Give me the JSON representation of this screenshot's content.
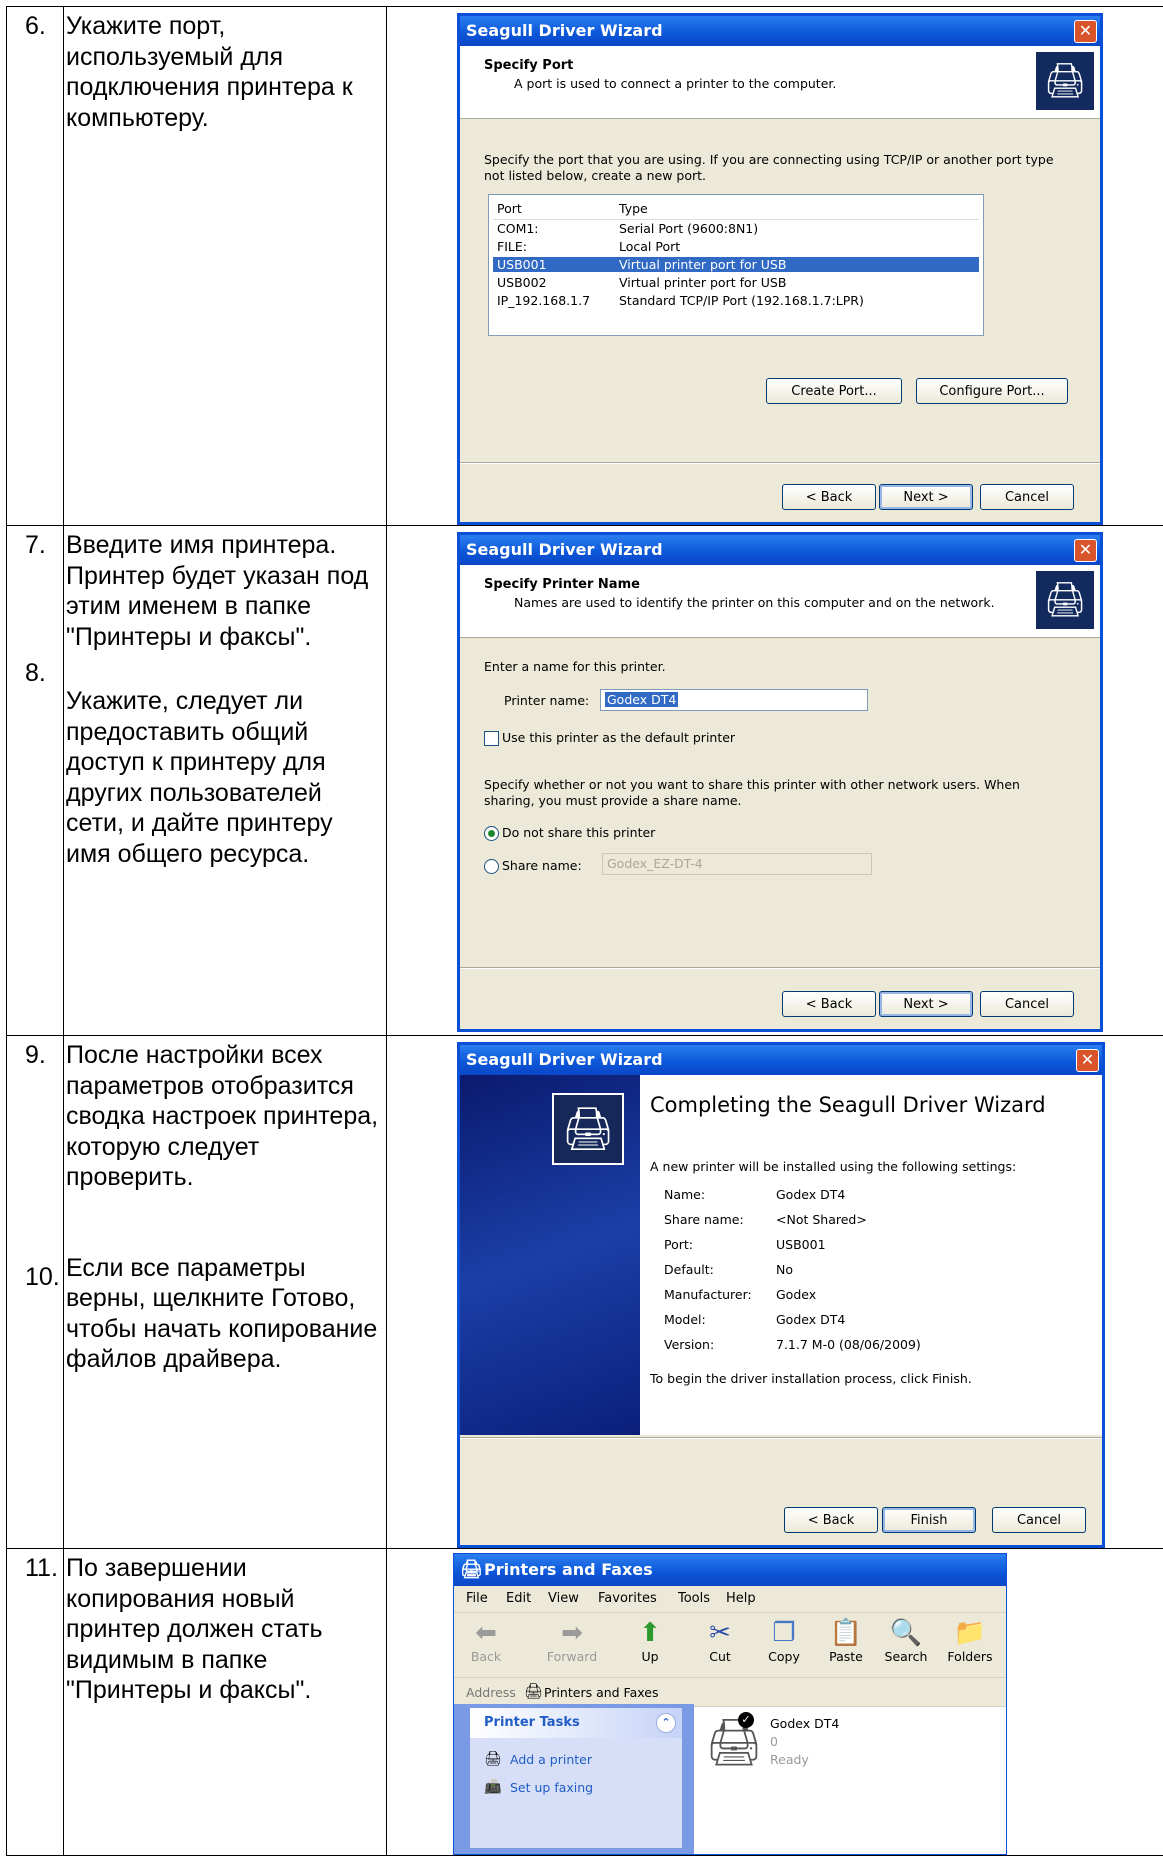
{
  "rows": [
    {
      "steps": [
        {
          "num": "6.",
          "text": "Укажите порт, используемый для подключения принтера к компьютеру."
        }
      ]
    },
    {
      "steps": [
        {
          "num": "7.",
          "text": "Введите имя принтера. Принтер будет указан под этим именем в папке \"Принтеры и факсы\"."
        },
        {
          "num": "8.",
          "text": "Укажите, следует ли предоставить общий доступ к принтеру для других пользователей сети, и дайте принтеру имя общего ресурса."
        }
      ]
    },
    {
      "steps": [
        {
          "num": "9.",
          "text": "После настройки всех параметров отобразится сводка настроек принтера, которую следует проверить."
        },
        {
          "num": "10.",
          "text": "Если все параметры верны, щелкните Готово, чтобы начать копирование файлов драйвера."
        }
      ]
    },
    {
      "steps": [
        {
          "num": "11.",
          "text": "По завершении копирования новый принтер должен стать видимым в папке \"Принтеры и факсы\"."
        }
      ]
    }
  ],
  "wizard": {
    "title": "Seagull Driver Wizard",
    "back": "< Back",
    "next": "Next >",
    "cancel": "Cancel",
    "finish": "Finish",
    "port": {
      "heading": "Specify Port",
      "subheading": "A port is used to connect a printer to the computer.",
      "instructions": "Specify the port that you are using.  If you are connecting using TCP/IP or another port type not listed below, create a new port.",
      "col_port": "Port",
      "col_type": "Type",
      "ports": [
        {
          "port": "COM1:",
          "type": "Serial Port (9600:8N1)"
        },
        {
          "port": "FILE:",
          "type": "Local Port"
        },
        {
          "port": "USB001",
          "type": "Virtual printer port for USB"
        },
        {
          "port": "USB002",
          "type": "Virtual printer port for USB"
        },
        {
          "port": "IP_192.168.1.7",
          "type": "Standard TCP/IP Port (192.168.1.7:LPR)"
        }
      ],
      "selected_index": 2,
      "create_port": "Create Port...",
      "configure_port": "Configure Port..."
    },
    "name": {
      "heading": "Specify Printer Name",
      "subheading": "Names are used to identify the printer on this computer and on the network.",
      "enter_label": "Enter a name for this printer.",
      "printer_name_label": "Printer name:",
      "printer_name_value": "Godex DT4",
      "default_checkbox": "Use this printer as the default printer",
      "share_instructions": "Specify whether or not you want to share this printer with other network users.  When sharing, you must provide a share name.",
      "no_share": "Do not share this printer",
      "share_label": "Share name:",
      "share_value": "Godex_EZ-DT-4"
    },
    "complete": {
      "heading": "Completing the Seagull Driver Wizard",
      "intro": "A new printer will be installed using the following settings:",
      "settings": [
        {
          "label": "Name:",
          "value": "Godex DT4"
        },
        {
          "label": "Share name:",
          "value": "<Not Shared>"
        },
        {
          "label": "Port:",
          "value": "USB001"
        },
        {
          "label": "Default:",
          "value": "No"
        },
        {
          "label": "Manufacturer:",
          "value": "Godex"
        },
        {
          "label": "Model:",
          "value": "Godex DT4"
        },
        {
          "label": "Version:",
          "value": "7.1.7 M-0 (08/06/2009)"
        }
      ],
      "outro": "To begin the driver installation process, click Finish."
    }
  },
  "explorer": {
    "title": "Printers and Faxes",
    "menu": [
      "File",
      "Edit",
      "View",
      "Favorites",
      "Tools",
      "Help"
    ],
    "toolbar": [
      {
        "label": "Back",
        "icon": "back-arrow-icon"
      },
      {
        "label": "Forward",
        "icon": "forward-arrow-icon"
      },
      {
        "label": "Up",
        "icon": "up-folder-icon"
      },
      {
        "label": "Cut",
        "icon": "scissors-icon"
      },
      {
        "label": "Copy",
        "icon": "copy-icon"
      },
      {
        "label": "Paste",
        "icon": "paste-icon"
      },
      {
        "label": "Search",
        "icon": "magnifier-icon"
      },
      {
        "label": "Folders",
        "icon": "folders-icon"
      }
    ],
    "address_label": "Address",
    "address_value": "Printers and Faxes",
    "tasks_title": "Printer Tasks",
    "tasks": [
      "Add a printer",
      "Set up faxing"
    ],
    "printer": {
      "name": "Godex DT4",
      "docs": "0",
      "status": "Ready"
    }
  }
}
